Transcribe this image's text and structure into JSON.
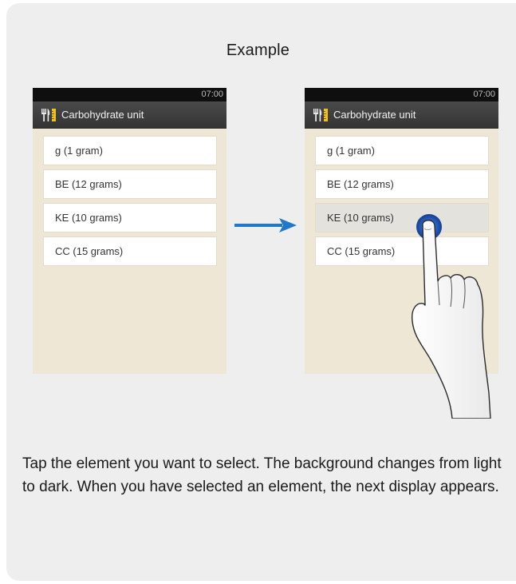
{
  "heading": "Example",
  "screen": {
    "time": "07:00",
    "title": "Carbohydrate unit",
    "title_icon": "fork-knife-ruler-icon",
    "items": [
      {
        "label": "g (1 gram)"
      },
      {
        "label": "BE (12 grams)"
      },
      {
        "label": "KE (10 grams)"
      },
      {
        "label": "CC (15 grams)"
      }
    ],
    "selected_item_after": "KE (10 grams)"
  },
  "colors": {
    "arrow": "#1f78c8",
    "tap_indicator": "#1e4fa8",
    "card_background": "#eeeeee",
    "screen_background": "#efe7d6"
  },
  "icons": {
    "arrow": "right-arrow-icon",
    "hand": "tapping-hand-icon"
  },
  "description": "Tap the element you want to select. The background changes from light to dark. When you have selected an element, the next display appears."
}
